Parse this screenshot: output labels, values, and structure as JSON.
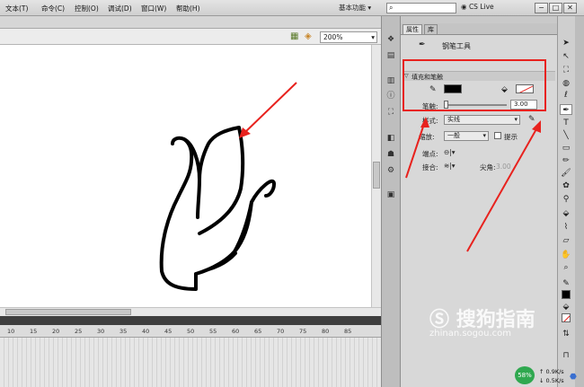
{
  "menubar": {
    "items": [
      "文本(T)",
      "命令(C)",
      "控制(O)",
      "调试(D)",
      "窗口(W)",
      "帮助(H)"
    ],
    "workspace": "基本功能 ▾",
    "cslive": "CS Live",
    "window_buttons": [
      "−",
      "□",
      "✕"
    ]
  },
  "stage": {
    "zoom": "200%"
  },
  "timeline": {
    "ticks": [
      "10",
      "15",
      "20",
      "25",
      "30",
      "35",
      "40",
      "45",
      "50",
      "55",
      "60",
      "65",
      "70",
      "75",
      "80",
      "85"
    ]
  },
  "panel": {
    "tabs": [
      "属性",
      "库"
    ],
    "tool_name": "钢笔工具",
    "section_fill_stroke": "填充和笔触",
    "stroke_label": "笔触:",
    "stroke_value": "3.00",
    "style_label": "样式:",
    "style_value": "实线",
    "scale_label": "缩放:",
    "scale_value": "一般",
    "hint_label": "提示",
    "cap_label": "端点:",
    "join_label": "接合:",
    "miter_label": "尖角:",
    "miter_value": "3.00"
  },
  "colors": {
    "accent_red": "#e8221e",
    "stroke_color": "#000000",
    "fill_color": "none"
  },
  "watermark": {
    "brand": "搜狗指南",
    "url": "zhinan.sogou.com"
  },
  "network": {
    "percent": "58%",
    "up": "0.9K/s",
    "down": "0.5K/s"
  },
  "icons": {
    "dock": [
      "motion-icon",
      "library-icon",
      "align-icon",
      "info-icon",
      "transform-icon",
      "color-icon",
      "swatch-icon",
      "components-icon"
    ],
    "tools": [
      "selection-icon",
      "subselect-icon",
      "free-transform-icon",
      "3d-rotation-icon",
      "lasso-icon",
      "pen-icon",
      "text-icon",
      "line-icon",
      "rectangle-icon",
      "pencil-icon",
      "brush-icon",
      "deco-icon",
      "bone-icon",
      "paint-bucket-icon",
      "eyedropper-icon",
      "eraser-icon",
      "hand-icon",
      "zoom-icon"
    ]
  }
}
